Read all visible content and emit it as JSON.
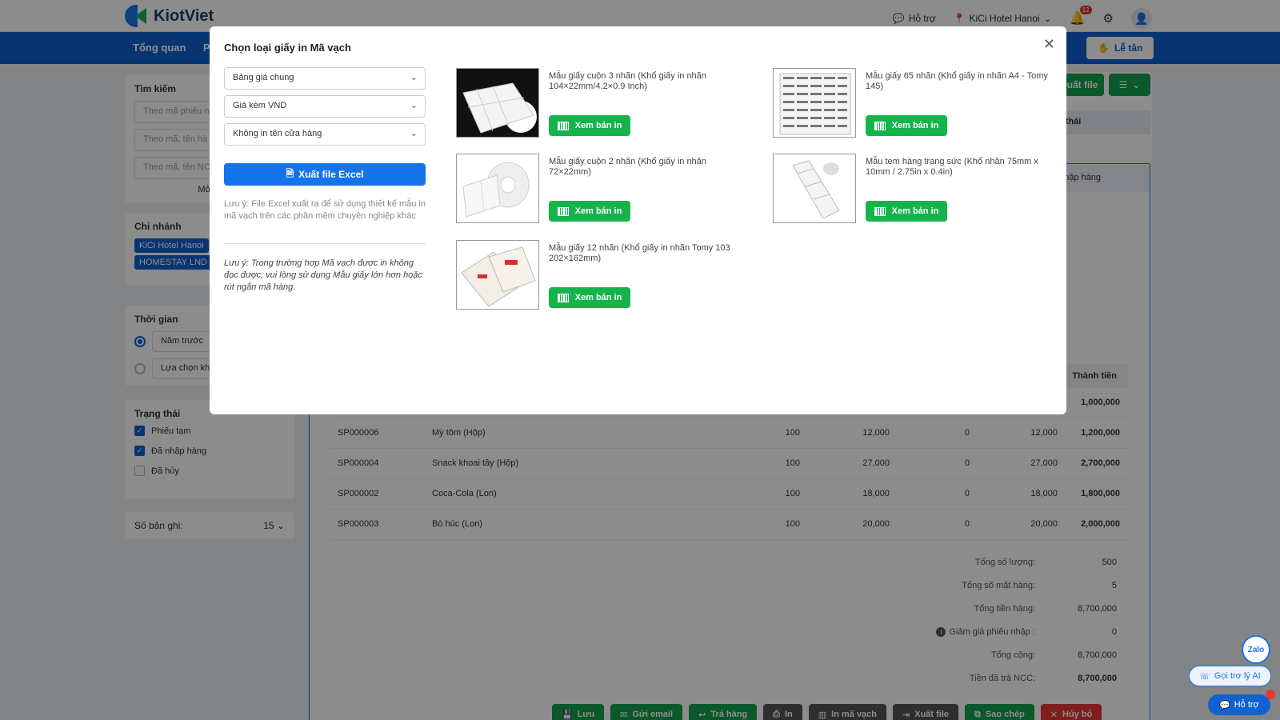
{
  "header": {
    "logo": "KiotViet",
    "support": "Hỗ trợ",
    "branch": "KiCi Hotel Hanoi",
    "notification_count": "12"
  },
  "nav": {
    "items": [
      "Tổng quan",
      "P"
    ],
    "receptionist": "Lễ tân"
  },
  "sidebar": {
    "search_title": "Tìm kiếm",
    "search_placeholders": [
      "Theo mã phiếu n",
      "Theo mã, tên hà",
      "Theo mã, tên NC"
    ],
    "more": "Mở rộ",
    "branch_title": "Chi nhánh",
    "branches": [
      "KiCi Hotel Hanoi",
      "HOMESTAY LND"
    ],
    "time_title": "Thời gian",
    "time_options": [
      "Năm trước",
      "Lựa chọn kh"
    ],
    "status_title": "Trạng thái",
    "status_options": [
      {
        "label": "Phiếu tạm",
        "checked": true
      },
      {
        "label": "Đã nhập hàng",
        "checked": true
      },
      {
        "label": "Đã hủy",
        "checked": false
      }
    ],
    "records_label": "Số bản ghi:",
    "records_value": "15"
  },
  "main": {
    "export_file": "uất file",
    "status_header": "g thái",
    "tab_imported": "nhập hàng",
    "col_total": "Thành tiền",
    "first_row_total": "1,000,000",
    "rows": [
      {
        "code": "SP000006",
        "name": "Mỳ tôm (Hộp)",
        "qty": "100",
        "price": "12,000",
        "discount": "0",
        "unit_price": "12,000",
        "total": "1,200,000"
      },
      {
        "code": "SP000004",
        "name": "Snack khoai tây (Hộp)",
        "qty": "100",
        "price": "27,000",
        "discount": "0",
        "unit_price": "27,000",
        "total": "2,700,000"
      },
      {
        "code": "SP000002",
        "name": "Coca-Cola (Lon)",
        "qty": "100",
        "price": "18,000",
        "discount": "0",
        "unit_price": "18,000",
        "total": "1,800,000"
      },
      {
        "code": "SP000003",
        "name": "Bò húc (Lon)",
        "qty": "100",
        "price": "20,000",
        "discount": "0",
        "unit_price": "20,000",
        "total": "2,000,000"
      }
    ],
    "summary": [
      {
        "label": "Tổng số lượng:",
        "value": "500"
      },
      {
        "label": "Tổng số mặt hàng:",
        "value": "5"
      },
      {
        "label": "Tổng tiền hàng:",
        "value": "8,700,000"
      },
      {
        "label": "Giảm giá phiếu nhập :",
        "value": "0"
      },
      {
        "label": "Tổng cộng:",
        "value": "8,700,000"
      },
      {
        "label": "Tiền đã trả NCC:",
        "value": "8,700,000"
      }
    ],
    "actions": [
      "Lưu",
      "Gửi email",
      "Trả hàng",
      "In",
      "In mã vạch",
      "Xuất file",
      "Sao chép",
      "Hủy bỏ"
    ]
  },
  "widgets": {
    "zalo": "Zalo",
    "ai_support": "Gọi trợ lý AI",
    "support": "Hỗ trợ"
  },
  "modal": {
    "title": "Chọn loại giấy in Mã vạch",
    "selects": [
      "Bảng giá chung",
      "Giá kèm VND",
      "Không in tên cửa hàng"
    ],
    "excel_button": "Xuất file Excel",
    "note_excel": "Lưu ý: File Excel xuất ra để sử dụng thiết kế mẫu in mã vạch trên các phần mềm chuyên nghiệp khác",
    "note_barcode": "Lưu ý: Trong trường hợp Mã vạch được in không đọc được, vui lòng sử dụng Mẫu giấy lớn hơn hoặc rút ngắn mã hàng.",
    "view_label": "Xem bản in",
    "papers": [
      {
        "desc": "Mẫu giấy cuộn 3 nhãn (Khổ giấy in nhãn 104×22mm/4.2×0.9 Inch)"
      },
      {
        "desc": "Mẫu giấy 65 nhãn (Khổ giấy in nhãn A4 - Tomy 145)"
      },
      {
        "desc": "Mẫu giấy cuộn 2 nhãn (Khổ giấy in nhãn 72×22mm)"
      },
      {
        "desc": "Mẫu tem hàng trang sức (Khổ nhãn 75mm x 10mm / 2.75in x 0.4in)"
      },
      {
        "desc": "Mẫu giấy 12 nhãn (Khổ giấy in nhãn Tomy 103 202×162mm)"
      }
    ]
  }
}
